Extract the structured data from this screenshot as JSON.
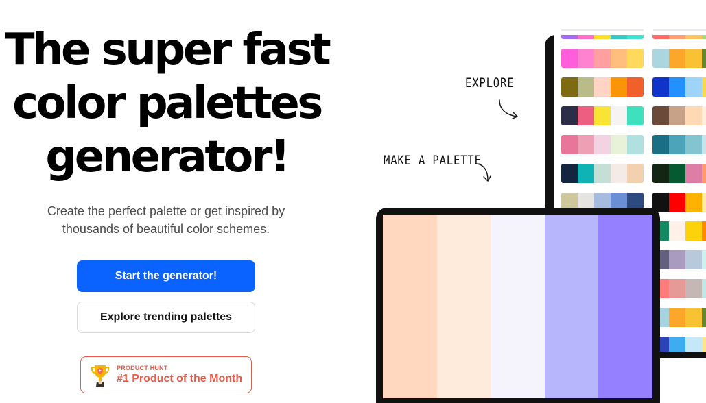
{
  "hero": {
    "title_lines": [
      "The super fast",
      "color palettes",
      "generator!"
    ],
    "subtitle_line1": "Create the perfect palette or get inspired by",
    "subtitle_line2": "thousands of beautiful color schemes."
  },
  "buttons": {
    "primary": "Start the generator!",
    "secondary": "Explore trending palettes"
  },
  "badge": {
    "kicker": "PRODUCT HUNT",
    "title": "#1 Product of the Month",
    "color": "#ea5a47",
    "icon": "trophy-icon"
  },
  "annotations": {
    "explore": "EXPLORE",
    "make": "MAKE A PALETTE"
  },
  "colors": {
    "primary_button": "#0a63ff",
    "title_text": "#000000",
    "subtitle_text": "#4b4b4b"
  },
  "front_palette": [
    "#ffd8bf",
    "#ffebdc",
    "#f5f4fc",
    "#b7b5fb",
    "#9580ff"
  ],
  "explore_palettes": {
    "column1": [
      [
        "#a56cf0",
        "#ff6ec7",
        "#ffde2b",
        "#3ac7c2",
        "#44e0d2"
      ],
      [
        "#ff5dd9",
        "#ff82d1",
        "#ff9fa1",
        "#ffbe7d",
        "#ffd85c"
      ],
      [
        "#7e6a10",
        "#b9bc89",
        "#ffd4c2",
        "#fb9507",
        "#f15f2a"
      ],
      [
        "#2c2e47",
        "#ee5e80",
        "#f8e435",
        "#f5f4f3",
        "#3fe0bd"
      ],
      [
        "#e8759a",
        "#ef9fb4",
        "#f3d2e1",
        "#e7f2d8",
        "#b1e0e0"
      ],
      [
        "#14263f",
        "#0fb3b4",
        "#c6dfd6",
        "#f4ebe7",
        "#f2d1b0"
      ],
      [
        "#cfc79c",
        "#e6e4e0",
        "#a5bbe0",
        "#6b8fd6",
        "#2d4b80"
      ]
    ],
    "column2": [
      [
        "#ff6a6a",
        "#ffa177",
        "#f9c466",
        "#a3d977",
        "#5fb85f"
      ],
      [
        "#abd6e0",
        "#fca62a",
        "#f9c232",
        "#62892f",
        "#3c5a18"
      ],
      [
        "#0f34c9",
        "#2291ff",
        "#9dd4f8",
        "#f9d94c",
        "#f0b21f"
      ],
      [
        "#6c4a3a",
        "#c8a288",
        "#ffd8b4",
        "#ffeedb",
        "#fff6ea"
      ],
      [
        "#1a6f85",
        "#4ba4b8",
        "#84c4d1",
        "#c8e4ea",
        "#eef7f9"
      ],
      [
        "#132513",
        "#055a32",
        "#de7ea6",
        "#ff9a6a",
        "#ffd2a1"
      ],
      [
        "#111111",
        "#ff0000",
        "#ffb300",
        "#ffe9a3",
        "#ffffff"
      ],
      [
        "#138a62",
        "#fff0e8",
        "#fcd20b",
        "#ff8a00",
        "#e94f37"
      ],
      [
        "#64607f",
        "#a99ac0",
        "#b8c9dc",
        "#cdf1ef",
        "#f0fffe"
      ],
      [
        "#fd7b7b",
        "#e69a97",
        "#c5b8b4",
        "#bfe8e6",
        "#eafaf8"
      ],
      [
        "#a7d3e1",
        "#fca62a",
        "#f9c232",
        "#62892f",
        "#3c5a18"
      ],
      [
        "#2c43b8",
        "#3dacf0",
        "#c5e8f9",
        "#ffe48a",
        "#f6a12c"
      ]
    ]
  }
}
